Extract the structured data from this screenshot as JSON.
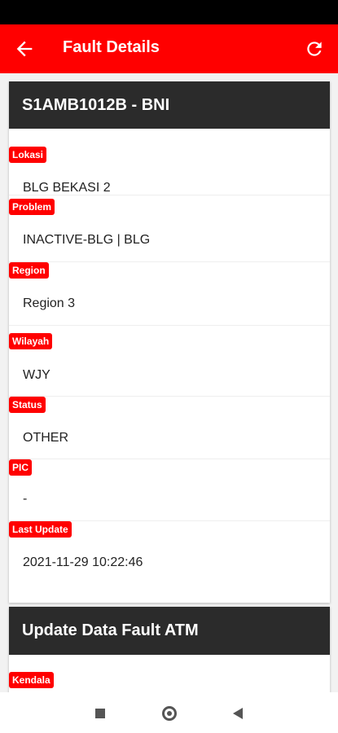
{
  "app_bar": {
    "title": "Fault Details",
    "back_icon": "arrow-left-icon",
    "refresh_icon": "refresh-icon"
  },
  "colors": {
    "accent": "#ff0000",
    "header_dark": "#2b2b2b"
  },
  "detail_card": {
    "title": "S1AMB1012B - BNI",
    "fields": [
      {
        "label": "Lokasi",
        "value": "BLG BEKASI 2"
      },
      {
        "label": "Problem",
        "value": "INACTIVE-BLG | BLG"
      },
      {
        "label": "Region",
        "value": "Region 3"
      },
      {
        "label": "Wilayah",
        "value": "WJY"
      },
      {
        "label": "Status",
        "value": "OTHER"
      },
      {
        "label": "PIC",
        "value": "-"
      },
      {
        "label": "Last Update",
        "value": "2021-11-29 10:22:46"
      }
    ]
  },
  "update_card": {
    "title": "Update Data Fault ATM",
    "fields": [
      {
        "label": "Kendala"
      }
    ]
  },
  "nav_bar": {
    "recents_icon": "square-icon",
    "home_icon": "circle-icon",
    "back_icon": "triangle-back-icon"
  }
}
